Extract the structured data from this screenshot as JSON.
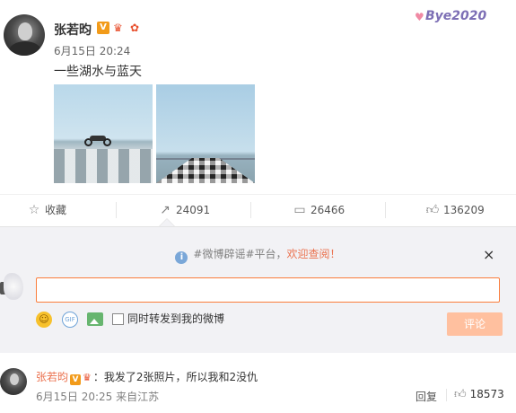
{
  "post": {
    "author": "张若昀",
    "badge_v": "V",
    "time": "6月15日 20:24",
    "text": "一些湖水与蓝天",
    "watermark": "Bye2020",
    "images": [
      "lake-motorcycle-photo",
      "lake-pier-photo"
    ]
  },
  "actions": {
    "favorite": "收藏",
    "forward_count": "24091",
    "comment_count": "26466",
    "like_count": "136209"
  },
  "composer": {
    "notice_tag": "#微博辟谣#平台，",
    "notice_highlight": "欢迎查阅！",
    "info_icon": "i",
    "close_icon": "×",
    "input_value": "",
    "forward_option": "同时转发到我的微博",
    "submit": "评论",
    "gif_label": "GIF"
  },
  "reply": {
    "author": "张若昀",
    "badge_v": "V",
    "text": "：我发了2张照片，所以我和2没仇",
    "time": "6月15日 20:25 来自江苏",
    "reply_label": "回复",
    "like_count": "18573"
  },
  "icons": {
    "favorite": "star-icon",
    "forward": "forward-icon",
    "comment": "comment-icon",
    "like": "thumbs-up-icon"
  },
  "colors": {
    "accent": "#eb7350",
    "input_border": "#fa7d3c",
    "submit_disabled": "#ffc09f",
    "vip_badge": "#f29b1a"
  }
}
